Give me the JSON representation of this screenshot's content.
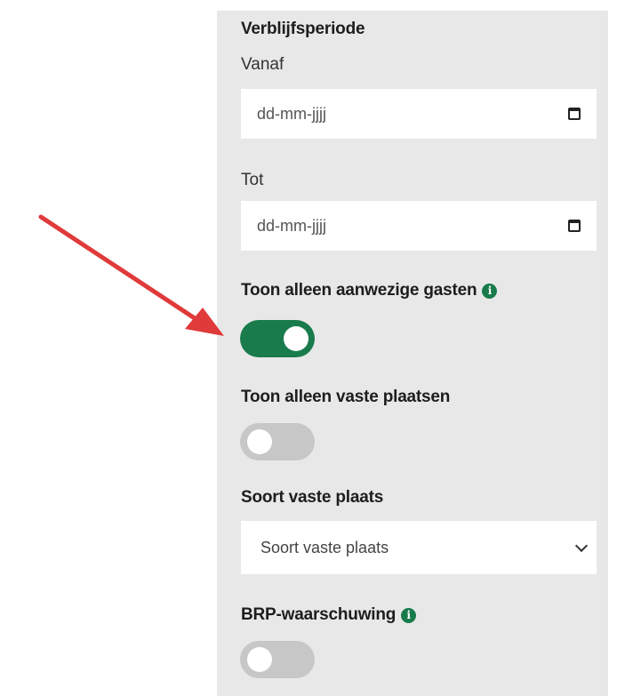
{
  "filters": {
    "stay_period_title": "Verblijfsperiode",
    "from_label": "Vanaf",
    "from_placeholder": "dd-mm-jjjj",
    "to_label": "Tot",
    "to_placeholder": "dd-mm-jjjj",
    "present_guests_label": "Toon alleen aanwezige gasten",
    "present_guests_on": true,
    "fixed_places_label": "Toon alleen vaste plaatsen",
    "fixed_places_on": false,
    "fixed_place_type_label": "Soort vaste plaats",
    "fixed_place_type_value": "Soort vaste plaats",
    "brp_warning_label": "BRP-waarschuwing",
    "brp_warning_on": false
  },
  "icons": {
    "info": "info-icon",
    "calendar": "calendar-icon",
    "chevron": "chevron-down-icon",
    "annotation_arrow": "red-arrow-icon"
  },
  "colors": {
    "accent": "#197b4c",
    "toggle_off": "#c7c7c7",
    "panel": "#e8e8e8",
    "arrow": "#e03a3a"
  }
}
